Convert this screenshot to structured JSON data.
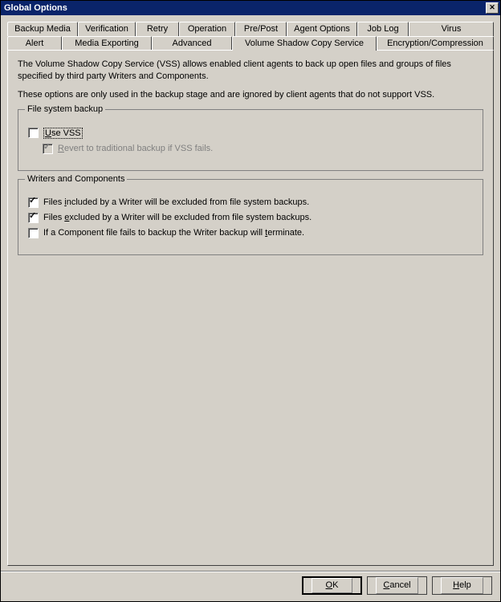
{
  "window": {
    "title": "Global Options"
  },
  "tabs": {
    "row1": [
      "Backup Media",
      "Verification",
      "Retry",
      "Operation",
      "Pre/Post",
      "Agent Options",
      "Job Log",
      "Virus"
    ],
    "row2": [
      "Alert",
      "Media Exporting",
      "Advanced",
      "Volume Shadow Copy Service",
      "Encryption/Compression"
    ],
    "selected": "Volume Shadow Copy Service"
  },
  "panel": {
    "desc1": "The Volume Shadow Copy Service (VSS) allows enabled client agents to back up open files and groups of files specified by third party Writers and Components.",
    "desc2": "These options are only used in the backup stage and are ignored by client agents that do not support VSS."
  },
  "fs_backup": {
    "legend": "File system backup",
    "use_vss": {
      "label_pre": "",
      "u": "U",
      "label_post": "se VSS",
      "checked": false,
      "focused": true
    },
    "revert": {
      "label_pre": "",
      "u": "R",
      "label_post": "evert to traditional backup if VSS fails.",
      "checked": true,
      "disabled": true
    }
  },
  "writers": {
    "legend": "Writers and Components",
    "opt1": {
      "label_pre": "Files ",
      "u": "i",
      "label_post": "ncluded by a Writer will be excluded from file system backups.",
      "checked": true
    },
    "opt2": {
      "label_pre": "Files ",
      "u": "e",
      "label_post": "xcluded by a Writer will be excluded from file system backups.",
      "checked": true
    },
    "opt3": {
      "label_pre": "If a Component file fails to backup the Writer backup will ",
      "u": "t",
      "label_post": "erminate.",
      "checked": false
    }
  },
  "buttons": {
    "ok": {
      "u": "O",
      "rest": "K"
    },
    "cancel": {
      "u": "C",
      "rest": "ancel"
    },
    "help": {
      "u": "H",
      "rest": "elp"
    }
  }
}
